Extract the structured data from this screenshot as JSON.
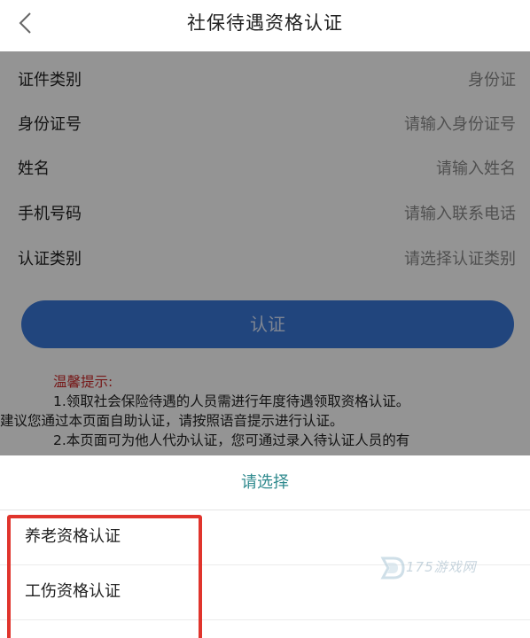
{
  "navbar": {
    "title": "社保待遇资格认证"
  },
  "form": {
    "rows": [
      {
        "label": "证件类别",
        "value": "身份证"
      },
      {
        "label": "身份证号",
        "placeholder": "请输入身份证号"
      },
      {
        "label": "姓名",
        "placeholder": "请输入姓名"
      },
      {
        "label": "手机号码",
        "placeholder": "请输入联系电话"
      },
      {
        "label": "认证类别",
        "placeholder": "请选择认证类别"
      }
    ],
    "submit_label": "认证"
  },
  "tips": {
    "title": "温馨提示:",
    "line1": "1.领取社会保险待遇的人员需进行年度待遇领取资格认证。",
    "line2": "建议您通过本页面自助认证，请按照语音提示进行认证。",
    "line3": "2.本页面可为他人代办认证，您可通过录入待认证人员的有"
  },
  "picker": {
    "title": "请选择",
    "options": [
      {
        "label": "养老资格认证"
      },
      {
        "label": "工伤资格认证"
      }
    ]
  },
  "watermark": {
    "text": "175游戏网"
  },
  "colors": {
    "accent": "#3a78d8",
    "picker_title": "#2f8a8e",
    "tips_title": "#cc2a2a",
    "highlight": "#e0342c"
  }
}
